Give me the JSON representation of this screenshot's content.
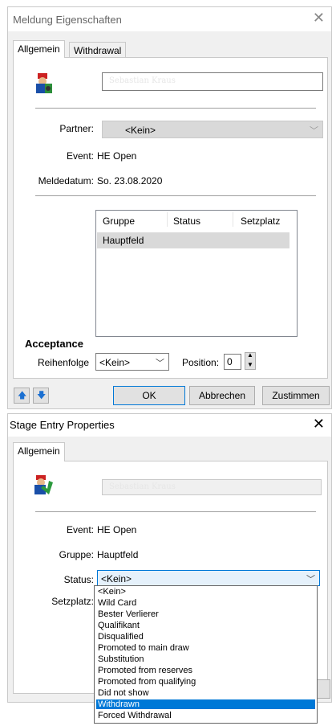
{
  "dialog1": {
    "title": "Meldung Eigenschaften",
    "tabs": [
      "Allgemein",
      "Withdrawal"
    ],
    "name_placeholder": "Sebastian Kraus",
    "labels": {
      "partner": "Partner:",
      "event": "Event:",
      "meldedatum": "Meldedatum:",
      "acceptance": "Acceptance",
      "reihenfolge": "Reihenfolge",
      "position": "Position:"
    },
    "values": {
      "partner": "<Kein>",
      "event": "HE Open",
      "meldedatum": "So. 23.08.2020",
      "reihenfolge": "<Kein>",
      "position": "0"
    },
    "table": {
      "headers": [
        "Gruppe",
        "Status",
        "Setzplatz"
      ],
      "rows": [
        [
          "Hauptfeld",
          "",
          ""
        ]
      ]
    },
    "buttons": {
      "ok": "OK",
      "cancel": "Abbrechen",
      "agree": "Zustimmen"
    }
  },
  "dialog2": {
    "title": "Stage Entry Properties",
    "tabs": [
      "Allgemein"
    ],
    "name_placeholder": "Sebastian Kraus",
    "labels": {
      "event": "Event:",
      "gruppe": "Gruppe:",
      "status": "Status:",
      "setzplatz": "Setzplatz:"
    },
    "values": {
      "event": "HE Open",
      "gruppe": "Hauptfeld",
      "status": "<Kein>"
    },
    "status_options": [
      "<Kein>",
      "Wild Card",
      "Bester Verlierer",
      "Qualifikant",
      "Disqualified",
      "Promoted to main draw",
      "Substitution",
      "Promoted from reserves",
      "Promoted from qualifying",
      "Did not show",
      "Withdrawn",
      "Forced Withdrawal"
    ],
    "selected_status_option": "Withdrawn"
  },
  "icons": {
    "close": "close-icon",
    "up": "arrow-up-icon",
    "down": "arrow-down-icon"
  },
  "colors": {
    "selection": "#0078d7",
    "dialog_bg": "#f0f0f0"
  }
}
